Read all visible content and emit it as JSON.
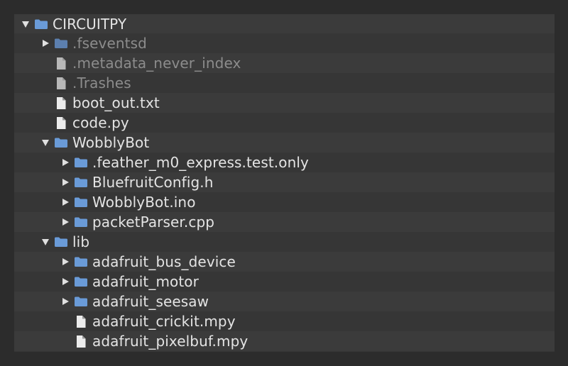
{
  "tree": {
    "root": {
      "label": "CIRCUITPY",
      "icon": "folder-icon",
      "expanded": true
    },
    "items": [
      {
        "label": ".fseventsd",
        "icon": "folder-icon",
        "type": "folder",
        "expanded": false,
        "dim": true
      },
      {
        "label": ".metadata_never_index",
        "icon": "file-icon",
        "type": "file",
        "dim": true
      },
      {
        "label": ".Trashes",
        "icon": "file-icon",
        "type": "file",
        "dim": true
      },
      {
        "label": "boot_out.txt",
        "icon": "file-icon",
        "type": "file"
      },
      {
        "label": "code.py",
        "icon": "file-icon",
        "type": "file"
      },
      {
        "label": "WobblyBot",
        "icon": "folder-icon",
        "type": "folder",
        "expanded": true,
        "children": [
          {
            "label": ".feather_m0_express.test.only",
            "icon": "folder-icon",
            "type": "folder",
            "expanded": false
          },
          {
            "label": "BluefruitConfig.h",
            "icon": "folder-icon",
            "type": "folder",
            "expanded": false
          },
          {
            "label": "WobblyBot.ino",
            "icon": "folder-icon",
            "type": "folder",
            "expanded": false
          },
          {
            "label": "packetParser.cpp",
            "icon": "folder-icon",
            "type": "folder",
            "expanded": false
          }
        ]
      },
      {
        "label": "lib",
        "icon": "folder-icon",
        "type": "folder",
        "expanded": true,
        "children": [
          {
            "label": "adafruit_bus_device",
            "icon": "folder-icon",
            "type": "folder",
            "expanded": false
          },
          {
            "label": "adafruit_motor",
            "icon": "folder-icon",
            "type": "folder",
            "expanded": false
          },
          {
            "label": "adafruit_seesaw",
            "icon": "folder-icon",
            "type": "folder",
            "expanded": false
          },
          {
            "label": "adafruit_crickit.mpy",
            "icon": "file-icon",
            "type": "file"
          },
          {
            "label": "adafruit_pixelbuf.mpy",
            "icon": "file-icon",
            "type": "file"
          }
        ]
      }
    ]
  },
  "colors": {
    "background": "#2c2c2c",
    "panel": "#363636",
    "row_alt": "#3b3b3b",
    "text": "#e4e4e4",
    "text_dim": "#8c8c8c",
    "folder_blue": "#6a9bd8"
  }
}
